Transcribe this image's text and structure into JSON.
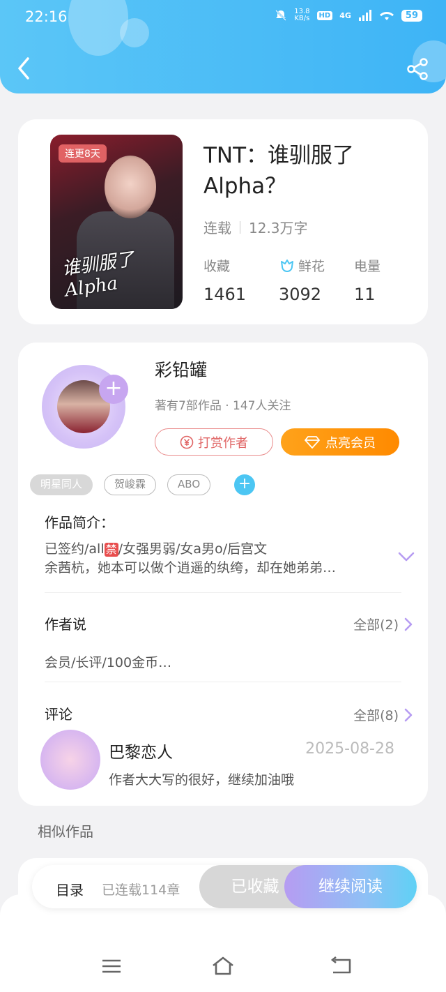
{
  "status_bar": {
    "time": "22:16",
    "net_speed": "13.8\nKB/s",
    "hd": "HD",
    "signal": "4G",
    "battery": "59"
  },
  "book": {
    "cover_badge": "连更8天",
    "cover_title": "谁驯服了 Alpha",
    "title": "TNT：谁驯服了Alpha？",
    "status": "连载",
    "word_count": "12.3万字",
    "stats": [
      {
        "label": "收藏",
        "value": "1461",
        "icon": ""
      },
      {
        "label": "鲜花",
        "value": "3092",
        "icon": "flower-icon"
      },
      {
        "label": "电量",
        "value": "11",
        "icon": ""
      }
    ]
  },
  "author": {
    "name": "彩铅罐",
    "sub": "著有7部作品 · 147人关注",
    "tip_button": "打赏作者",
    "vip_button": "点亮会员"
  },
  "tags": [
    "明星同人",
    "贺峻霖",
    "ABO"
  ],
  "intro": {
    "heading": "作品简介：",
    "line1_prefix": "已签约/all",
    "ban": "禁",
    "line1_suffix": "/女强男弱/女a男o/后宫文",
    "line2": "余茜杭，她本可以做个逍遥的纨绔，却在她弟弟…"
  },
  "author_says": {
    "heading": "作者说",
    "all_link": "全部(2)",
    "text": "会员/长评/100金币…"
  },
  "comments": {
    "heading": "评论",
    "all_link": "全部(8)",
    "user": "巴黎恋人",
    "date": "2025-08-28",
    "text": "作者大大写的很好，继续加油哦"
  },
  "similar": {
    "heading": "相似作品"
  },
  "action_bar": {
    "toc": "目录",
    "chapter_count": "已连载114章",
    "collected": "已收藏",
    "read": "继续阅读"
  },
  "colors": {
    "header": "#3eb4f6",
    "vip": "#ff8a00",
    "tip": "#e06565",
    "accent_purple": "#c7a6f0"
  }
}
